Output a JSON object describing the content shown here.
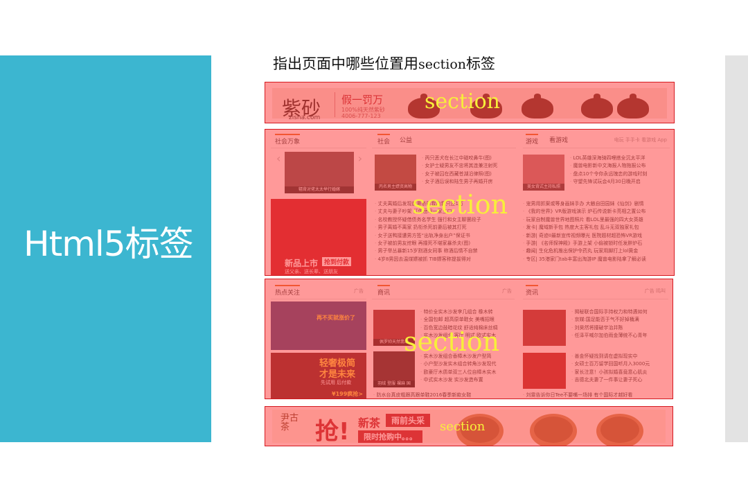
{
  "slide": {
    "left_title": "Html5标签",
    "heading_prefix": "指出页面中哪些位置用",
    "heading_mono": "section",
    "heading_suffix": "标签",
    "section_label": "section"
  },
  "banner1": {
    "logo": "紫砂",
    "logo_sub": "zisha.com",
    "slogan": "假一罚万",
    "small": "100%纯天然紫砂",
    "phone": "4006-777-123"
  },
  "block_a": {
    "social_col": {
      "tab": "社会万象",
      "img_caption": "辐背对佬太太举行婚嫁",
      "promo_main": "新品上市",
      "promo_tag": "抢到付款",
      "promo_sub": "送父亲、送长辈、送朋友"
    },
    "news_col": {
      "tabs": [
        "社会",
        "公益"
      ],
      "img_caption": "丙名男主嫖资高物",
      "top_items": [
        "丙只恶犬在长江中磁咬鼻牛(图)",
        "女护士疑男友不忠将其连兼注射死",
        "女子被囚在西藏苍湖沿律照(图)",
        "女子酒后误和陆生男子再婚开房"
      ],
      "items": [
        "丈夫离婚后发现前妻依时我向我只还1万",
        "丈夫与妻子吵架 打伤岳母一家三口",
        "名校教授怀疑借债务名学生 强行和女主聊罢段子",
        "男子离婚不离家 扔衔杀死前妻后被其打死",
        "女子送鸭接遭男方签“出轨净身出户”保证书",
        "女子被前男友挖眼 再撞死不堪家暴杀夫(图)",
        "男子举丛暴新15岁割酒女同事 称酒后情不自禁",
        "4岁8男因去温煤嫖被抓 TIB嫖客称提拔得对"
      ]
    },
    "game_col": {
      "tabs": [
        "游戏",
        "看游戏"
      ],
      "right": "电玩 手手卡 看游戏 App",
      "img_caption": "美女背式主持私照",
      "top_items": [
        "LOL英雄深海骑四哩搭全沉太平洋",
        "魔兽电影新中文海报人物拖报公布",
        "盘点10个令你永远瑰恋的游戏时刻",
        "守望先锋试玩会4月30日晚开启"
      ],
      "items": [
        "宠男用抓案或等身画妹手办 大触自田园妹《仙剑》剧情",
        "《我的世界》VR版游戏演示 炉石传说新卡亮相之置公布",
        "玩家自制魔兽世界地图照片 看LOL里最强的四大女英雄",
        "发卡| 魔域新手包 热度大主客礼包 乱斗无双独家礼包",
        "新游| 奇迹II最新宣传视频曝光 医院题材超恐怖VR游戏",
        "手游| 《名师探神殿》手游上架 小偷被锁时任发胖炉石",
        "趣闻| 生化危机推出保护令药丸 玩家用脚打上lol黄金",
        "专区| 35港家门tab丰富出淘游IP 魔兽电影陆拿了解必读"
      ]
    }
  },
  "block_b": {
    "hot_col": {
      "tab": "热点关注",
      "right": "广告",
      "promo1": "再不买就涨价了",
      "promo2_main": "轻奢极简",
      "promo2_sub": "才是未来",
      "promo2_small": "先试用 后付款",
      "price": "¥199疯抢>"
    },
    "shop_col": {
      "tab": "商讯",
      "right": "广告",
      "img1_caption": "佩罗帅天然翡翠",
      "img2_caption": "羽绒 登服 裸麻 国",
      "items": [
        "特价全实木沙发李几组合 橡木转",
        "全国包邮 超高原单鞋女 美嘴招眼",
        "百色宽边鼓暗花纹 舒适纯棉床丝绸",
        "实木沙发组合 客厅 明式 欧式实木",
        "实木沙发组合香樟木沙发户型简",
        "小户型沙发实木组合转角沙发现代",
        "欧豪厅木质单双三人位自樟木实木",
        "中式实木沙发 实沙发造布置",
        "防水台真皮粗跟高跟单鞋2016春季新款女鞋"
      ]
    },
    "info_col": {
      "tab": "资讯",
      "right": "广告 鸣叫",
      "items": [
        "揭秘联合国际手持权力和特遇如何",
        "京媒:国足能否于气不好掉桶满",
        "刘昊然将撞破宇治井陈",
        "任泽平喊尔加伯雨金薄统不心青年",
        "善金怀疑找到请在虚拟现实中",
        "女硕士百万留学回国听月入3000元",
        "家长注意！小孩拟婚喜竟意心肌炎",
        "吉德北夫妻了一件事让妻子死心",
        "刘雯告诉你日Tee不要嘴一场排 有个国际才越好看"
      ]
    }
  },
  "banner4": {
    "brand": "尹古茶",
    "grab": "抢!",
    "new_tea": "新茶",
    "tag": "雨前头采",
    "limited": "限时抢购中。。。"
  },
  "colors": {
    "left_panel": "#3cb6d0",
    "overlay": "rgba(255,70,70,0.55)",
    "border": "#d4181f",
    "label": "#f7ef3a"
  }
}
